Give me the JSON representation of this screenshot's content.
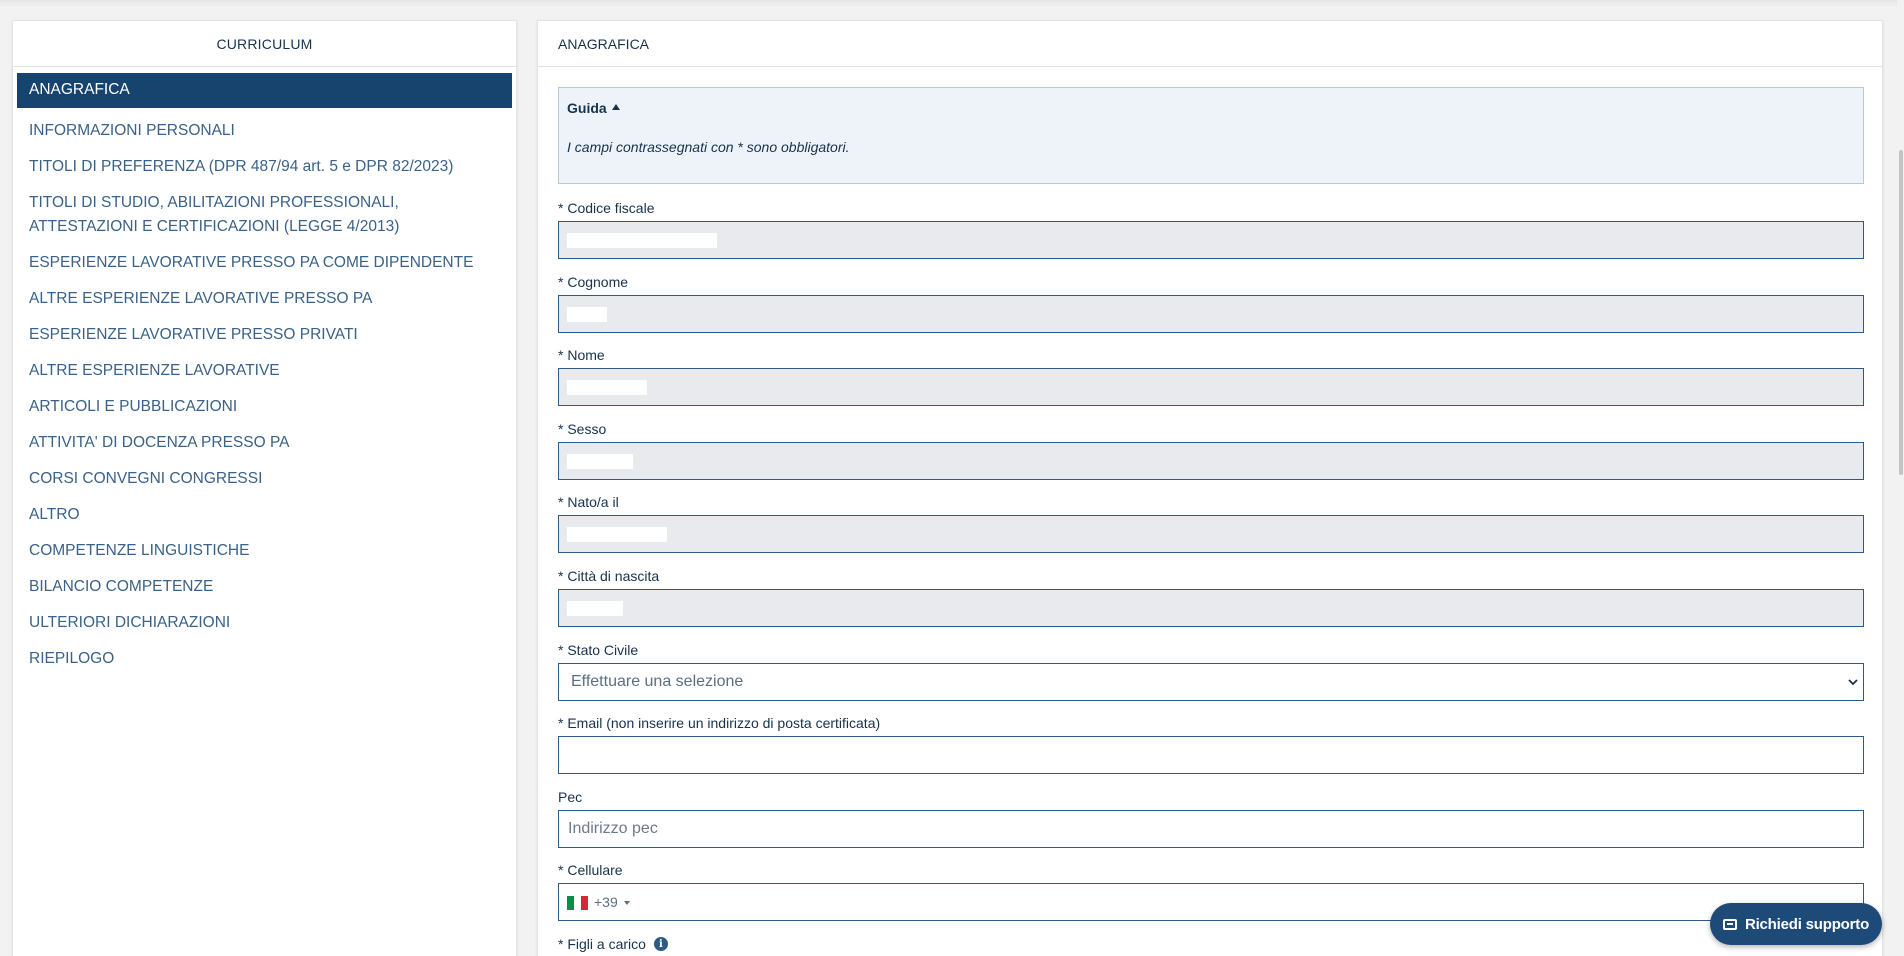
{
  "sidebar": {
    "title": "CURRICULUM",
    "items": [
      {
        "label": "ANAGRAFICA"
      },
      {
        "label": "INFORMAZIONI PERSONALI"
      },
      {
        "label": "TITOLI DI PREFERENZA (DPR 487/94 art. 5 e DPR 82/2023)"
      },
      {
        "label": "TITOLI DI STUDIO, ABILITAZIONI PROFESSIONALI, ATTESTAZIONI E CERTIFICAZIONI (LEGGE 4/2013)"
      },
      {
        "label": "ESPERIENZE LAVORATIVE PRESSO PA COME DIPENDENTE"
      },
      {
        "label": "ALTRE ESPERIENZE LAVORATIVE PRESSO PA"
      },
      {
        "label": "ESPERIENZE LAVORATIVE PRESSO PRIVATI"
      },
      {
        "label": "ALTRE ESPERIENZE LAVORATIVE"
      },
      {
        "label": "ARTICOLI E PUBBLICAZIONI"
      },
      {
        "label": "ATTIVITA' DI DOCENZA PRESSO PA"
      },
      {
        "label": "CORSI CONVEGNI CONGRESSI"
      },
      {
        "label": "ALTRO"
      },
      {
        "label": "COMPETENZE LINGUISTICHE"
      },
      {
        "label": "BILANCIO COMPETENZE"
      },
      {
        "label": "ULTERIORI DICHIARAZIONI"
      },
      {
        "label": "RIEPILOGO"
      }
    ]
  },
  "main": {
    "title": "ANAGRAFICA",
    "guide": {
      "title": "Guida",
      "text": "I campi contrassegnati con * sono obbligatori."
    },
    "fields": {
      "codice_fiscale": {
        "label": "* Codice fiscale"
      },
      "cognome": {
        "label": "* Cognome"
      },
      "nome": {
        "label": "* Nome"
      },
      "sesso": {
        "label": "* Sesso"
      },
      "nato_il": {
        "label": "* Nato/a il"
      },
      "citta_nascita": {
        "label": "* Città di nascita"
      },
      "stato_civile": {
        "label": "* Stato Civile",
        "value": "Effettuare una selezione"
      },
      "email": {
        "label": "* Email (non inserire un indirizzo di posta certificata)",
        "value": ""
      },
      "pec": {
        "label": "Pec",
        "placeholder": "Indirizzo pec"
      },
      "cellulare": {
        "label": "* Cellulare",
        "dial_code": "+39"
      },
      "figli": {
        "label": "* Figli a carico"
      }
    }
  },
  "support_button": {
    "label": "Richiedi supporto"
  },
  "colors": {
    "primary": "#17446f",
    "text": "#17324d",
    "link": "#3a6188",
    "input_border": "#2e5a86",
    "disabled_bg": "#e8eaed",
    "guide_bg": "#eef3fa"
  },
  "icons": [
    "caret-up-icon",
    "chevron-down-icon",
    "italy-flag-icon",
    "info-icon",
    "mail-icon"
  ]
}
